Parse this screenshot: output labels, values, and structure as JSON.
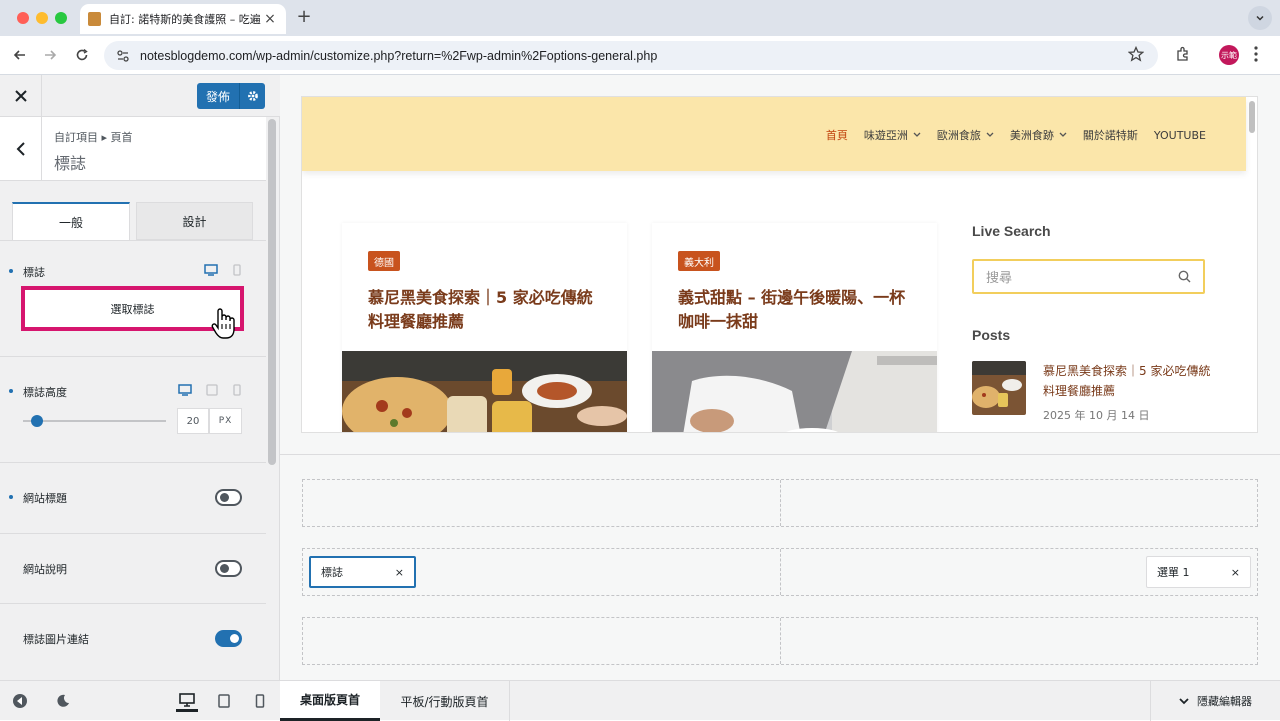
{
  "browser": {
    "tab_title": "自訂: 諾特斯的美食護照 – 吃遍",
    "tab_close": "×",
    "new_tab": "+",
    "url": "notesblogdemo.com/wp-admin/customize.php?return=%2Fwp-admin%2Foptions-general.php",
    "profile": "示範"
  },
  "sidebar": {
    "publish_label": "發佈",
    "breadcrumb": "自訂項目 ▸ 頁首",
    "section_title": "標誌",
    "tabs": [
      "一般",
      "設計"
    ],
    "logo": {
      "label": "標誌",
      "button": "選取標誌"
    },
    "logo_height": {
      "label": "標誌高度",
      "value": "20",
      "unit": "PX",
      "slider_fraction": 0.1
    },
    "site_title": {
      "label": "網站標題",
      "enabled": false
    },
    "site_desc": {
      "label": "網站說明",
      "enabled": false
    },
    "logo_link": {
      "label": "標誌圖片連結",
      "enabled": true
    }
  },
  "preview": {
    "menu": [
      {
        "label": "首頁",
        "dropdown": false,
        "current": true
      },
      {
        "label": "味遊亞洲",
        "dropdown": true
      },
      {
        "label": "歐洲食旅",
        "dropdown": true
      },
      {
        "label": "美洲食跡",
        "dropdown": true
      },
      {
        "label": "關於諾特斯",
        "dropdown": false
      },
      {
        "label": "YOUTUBE",
        "dropdown": false
      }
    ],
    "cards": [
      {
        "badge": "德國",
        "title": "慕尼黑美食探索｜5 家必吃傳統料理餐廳推薦"
      },
      {
        "badge": "義大利",
        "title": "義式甜點 – 街邊午後暖陽、一杯咖啡一抹甜"
      }
    ],
    "aside": {
      "search_heading": "Live Search",
      "search_placeholder": "搜尋",
      "posts_heading": "Posts",
      "post_title": "慕尼黑美食探索｜5 家必吃傳統料理餐廳推薦",
      "post_date": "2025 年 10 月 14 日"
    }
  },
  "builder": {
    "logo_chip": "標誌",
    "menu_chip": "選單 1",
    "close_glyph": "×"
  },
  "bottom": {
    "tabs": [
      "桌面版頁首",
      "平板/行動版頁首"
    ],
    "hide_editor": "隱藏編輯器"
  },
  "colors": {
    "accent": "#2271b1",
    "highlight": "#d6156e",
    "header_bg": "#fbe6aa",
    "badge": "#c8531e"
  }
}
